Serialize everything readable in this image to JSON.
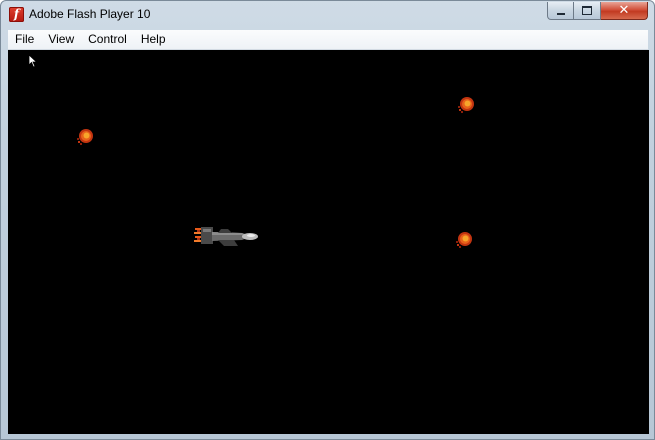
{
  "window": {
    "title": "Adobe Flash Player 10",
    "app_icon": "flash-icon",
    "app_icon_glyph": "f",
    "controls": {
      "minimize": "minimize-icon",
      "maximize": "maximize-icon",
      "close": "close-icon",
      "close_glyph": "✕"
    }
  },
  "menu": {
    "items": [
      {
        "label": "File"
      },
      {
        "label": "View"
      },
      {
        "label": "Control"
      },
      {
        "label": "Help"
      }
    ]
  },
  "stage": {
    "background": "#000000",
    "sprites": {
      "player": "spaceship-sprite",
      "enemies": [
        "fireball-sprite",
        "fireball-sprite",
        "fireball-sprite"
      ]
    },
    "cursor": "arrow-cursor-icon"
  },
  "colors": {
    "fireball_outer": "#c23410",
    "fireball_inner": "#f7a52a",
    "ship_body": "#6b6b6b",
    "ship_thruster": "#e85a1a"
  }
}
